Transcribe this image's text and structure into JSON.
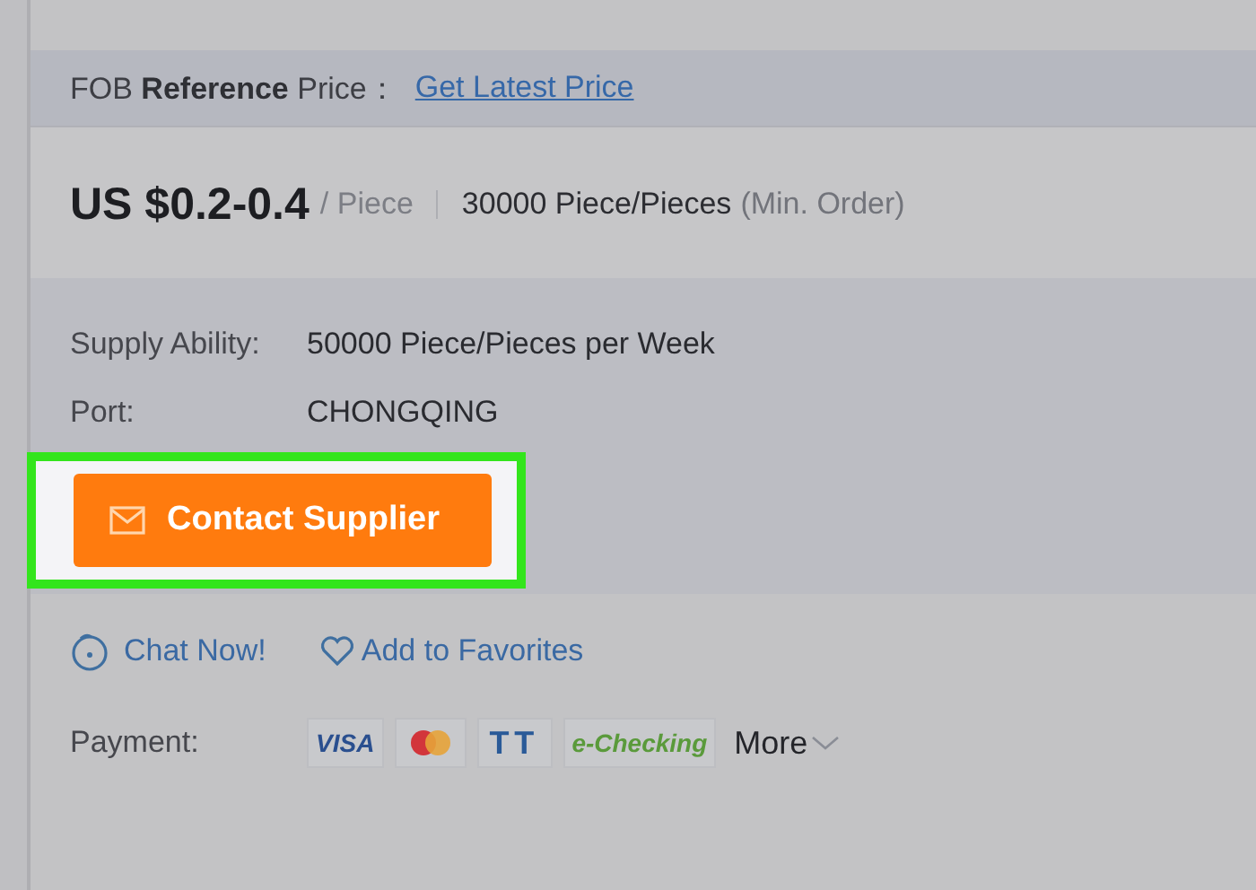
{
  "reference_price": {
    "prefix": "FOB",
    "bold": "Reference",
    "suffix": "Price：",
    "link": "Get Latest Price"
  },
  "price": {
    "amount": "US $0.2-0.4",
    "unit": "/ Piece",
    "min_quantity": "30000 Piece/Pieces",
    "min_note": "(Min. Order)"
  },
  "details": [
    {
      "label": "Supply Ability:",
      "value": "50000 Piece/Pieces per Week"
    },
    {
      "label": "Port:",
      "value": "CHONGQING"
    }
  ],
  "contact_button": {
    "label": "Contact Supplier",
    "highlighted": true
  },
  "actions": [
    {
      "kind": "chat",
      "label": "Chat Now!"
    },
    {
      "kind": "favorite",
      "label": "Add to Favorites"
    }
  ],
  "payment": {
    "label": "Payment:",
    "methods": [
      {
        "kind": "visa",
        "label": "VISA"
      },
      {
        "kind": "mastercard"
      },
      {
        "kind": "tt",
        "label": "TT"
      },
      {
        "kind": "echeck",
        "label": "e-Checking"
      }
    ],
    "more": "More"
  }
}
